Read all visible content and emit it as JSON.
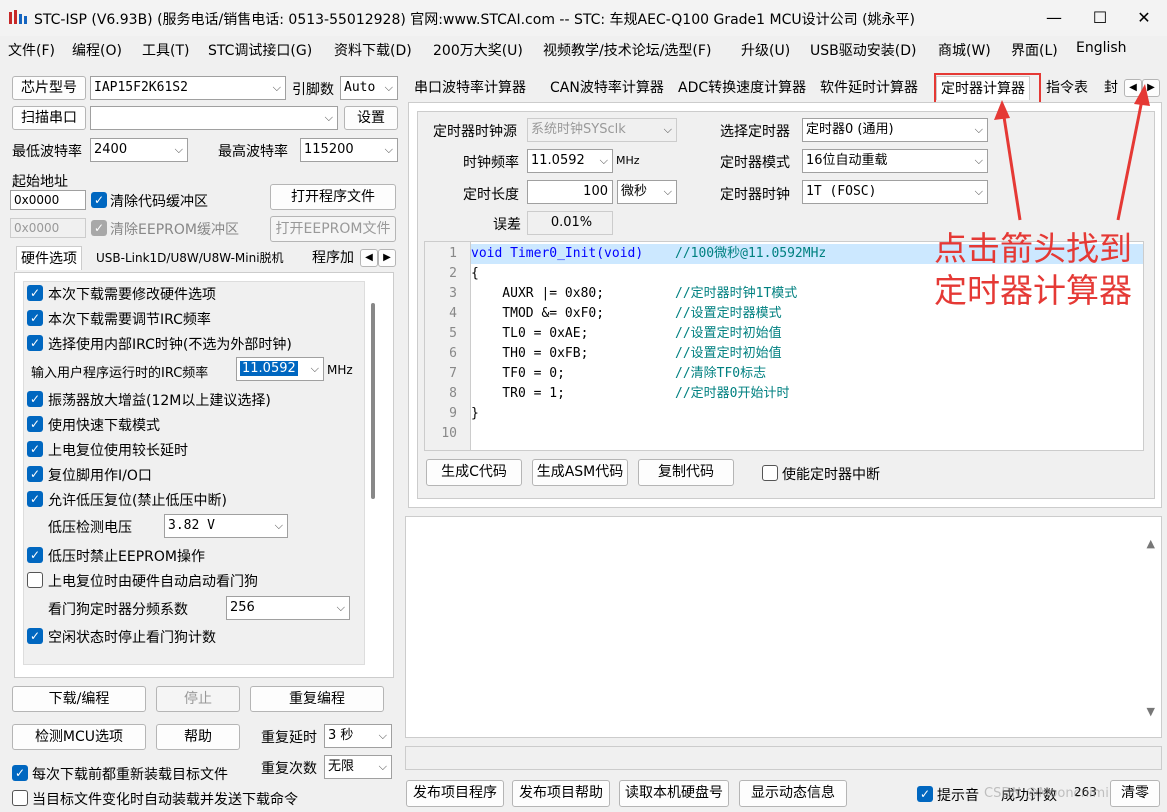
{
  "window": {
    "title": "STC-ISP (V6.93B) (服务电话/销售电话: 0513-55012928) 官网:www.STCAI.com  -- STC: 车规AEC-Q100 Grade1 MCU设计公司 (姚永平)",
    "minimize": "—",
    "maximize": "☐",
    "close": "✕"
  },
  "menu": [
    "文件(F)",
    "编程(O)",
    "工具(T)",
    "STC调试接口(G)",
    "资料下载(D)",
    "200万大奖(U)",
    "视频教学/技术论坛/选型(F)",
    "升级(U)",
    "USB驱动安装(D)",
    "商城(W)",
    "界面(L)",
    "English"
  ],
  "left": {
    "chip_label": "芯片型号",
    "chip_value": "IAP15F2K61S2",
    "pins_label": "引脚数",
    "pins_value": "Auto",
    "scan_btn": "扫描串口",
    "port_value": "",
    "settings_btn": "设置",
    "min_baud_label": "最低波特率",
    "min_baud_value": "2400",
    "max_baud_label": "最高波特率",
    "max_baud_value": "115200",
    "start_addr_label": "起始地址",
    "addr1": "0x0000",
    "clear_code_label": "清除代码缓冲区",
    "open_prog_btn": "打开程序文件",
    "addr2": "0x0000",
    "clear_eeprom_label": "清除EEPROM缓冲区",
    "open_eeprom_btn": "打开EEPROM文件",
    "tabs": [
      "硬件选项",
      "USB-Link1D/U8W/U8W-Mini脱机",
      "程序加"
    ],
    "hw": {
      "o1": "本次下载需要修改硬件选项",
      "o2": "本次下载需要调节IRC频率",
      "o3": "选择使用内部IRC时钟(不选为外部时钟)",
      "irc_label": "输入用户程序运行时的IRC频率",
      "irc_value": "11.0592",
      "irc_unit": "MHz",
      "o4": "振荡器放大增益(12M以上建议选择)",
      "o5": "使用快速下载模式",
      "o6": "上电复位使用较长延时",
      "o7": "复位脚用作I/O口",
      "o8": "允许低压复位(禁止低压中断)",
      "lv_label": "低压检测电压",
      "lv_value": "3.82 V",
      "o9": "低压时禁止EEPROM操作",
      "o10": "上电复位时由硬件自动启动看门狗",
      "wdt_label": "看门狗定时器分频系数",
      "wdt_value": "256",
      "o11": "空闲状态时停止看门狗计数"
    },
    "download_btn": "下载/编程",
    "stop_btn": "停止",
    "reprog_btn": "重复编程",
    "detect_btn": "检测MCU选项",
    "help_btn": "帮助",
    "repeat_delay_label": "重复延时",
    "repeat_delay_value": "3 秒",
    "repeat_count_label": "重复次数",
    "repeat_count_value": "无限",
    "reload_label": "每次下载前都重新装载目标文件",
    "autoload_label": "当目标文件变化时自动装载并发送下载命令"
  },
  "right": {
    "tabs": [
      "串口波特率计算器",
      "CAN波特率计算器",
      "ADC转换速度计算器",
      "软件延时计算器",
      "定时器计算器",
      "指令表",
      "封"
    ],
    "timer": {
      "clk_src_label": "定时器时钟源",
      "clk_src_value": "系统时钟SYSclk",
      "sel_label": "选择定时器",
      "sel_value": "定时器0 (通用)",
      "freq_label": "时钟频率",
      "freq_value": "11.0592",
      "freq_unit": "MHz",
      "mode_label": "定时器模式",
      "mode_value": "16位自动重载",
      "len_label": "定时长度",
      "len_value": "100",
      "len_unit": "微秒",
      "tclk_label": "定时器时钟",
      "tclk_value": "1T  (FOSC)",
      "err_label": "误差",
      "err_value": "0.01%"
    },
    "code_lines": [
      {
        "n": "1",
        "code": "void Timer0_Init(void)",
        "comment": "//100微秒@11.0592MHz"
      },
      {
        "n": "2",
        "code": "{",
        "comment": ""
      },
      {
        "n": "3",
        "code": "    AUXR |= 0x80;",
        "comment": "//定时器时钟1T模式"
      },
      {
        "n": "4",
        "code": "    TMOD &= 0xF0;",
        "comment": "//设置定时器模式"
      },
      {
        "n": "5",
        "code": "    TL0 = 0xAE;",
        "comment": "//设置定时初始值"
      },
      {
        "n": "6",
        "code": "    TH0 = 0xFB;",
        "comment": "//设置定时初始值"
      },
      {
        "n": "7",
        "code": "    TF0 = 0;",
        "comment": "//清除TF0标志"
      },
      {
        "n": "8",
        "code": "    TR0 = 1;",
        "comment": "//定时器0开始计时"
      },
      {
        "n": "9",
        "code": "}",
        "comment": ""
      },
      {
        "n": "10",
        "code": "",
        "comment": ""
      }
    ],
    "gen_c_btn": "生成C代码",
    "gen_asm_btn": "生成ASM代码",
    "copy_btn": "复制代码",
    "enable_int_label": "使能定时器中断",
    "annotation": [
      "点击箭头找到",
      "定时器计算器"
    ],
    "bottom": {
      "publish_btn": "发布项目程序",
      "publish_help_btn": "发布项目帮助",
      "read_disk_btn": "读取本机硬盘号",
      "show_dyn_btn": "显示动态信息",
      "sound_label": "提示音",
      "success_label": "成功计数",
      "success_value": "263",
      "clear_btn": "清零",
      "watermark": "CSDN @Mooncnimi"
    }
  },
  "colors": {
    "annotation_red": "#e53935",
    "check_blue": "#0067c0",
    "highlight": "#cce8ff"
  }
}
